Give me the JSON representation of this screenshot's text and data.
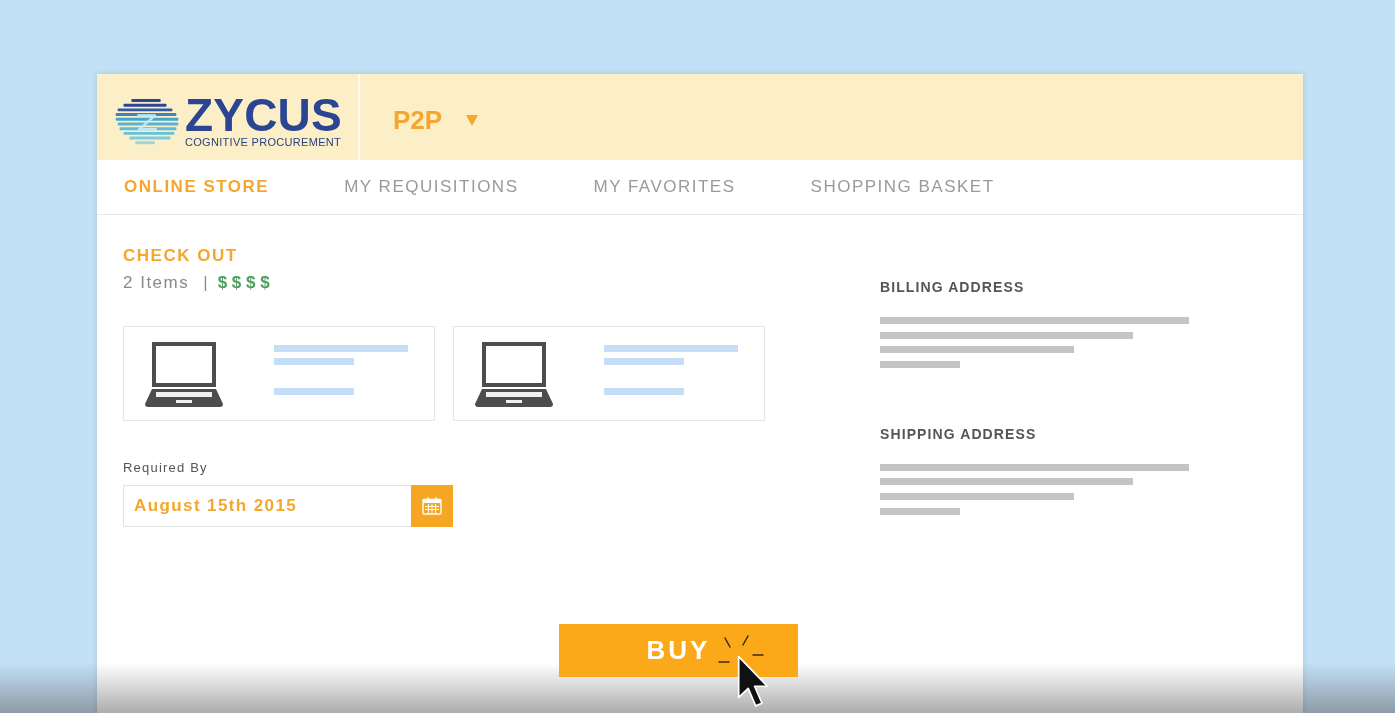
{
  "header": {
    "brand": "ZYCUS",
    "tagline": "COGNITIVE PROCUREMENT",
    "module_menu": {
      "label": "P2P"
    }
  },
  "tabs": [
    {
      "label": "ONLINE STORE",
      "selected": true
    },
    {
      "label": "MY REQUISITIONS",
      "selected": false
    },
    {
      "label": "MY FAVORITES",
      "selected": false
    },
    {
      "label": "SHOPPING BASKET",
      "selected": false
    }
  ],
  "checkout": {
    "title": "CHECK OUT",
    "item_count": "2 Items",
    "separator": "|",
    "price": "$ $ $ $"
  },
  "cart_items": [
    {
      "kind": "product"
    },
    {
      "kind": "product"
    }
  ],
  "required_by": {
    "label": "Required By",
    "value": "August 15th 2015"
  },
  "addresses": [
    {
      "title": "BILLING ADDRESS"
    },
    {
      "title": "SHIPPING ADDRESS"
    }
  ],
  "buy_button": {
    "label": "BUY"
  }
}
